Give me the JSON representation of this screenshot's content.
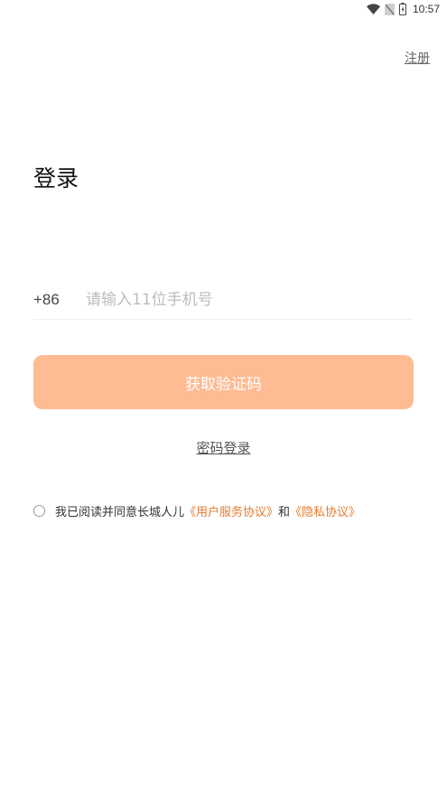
{
  "status_bar": {
    "time": "10:57",
    "icons": [
      "wifi-icon",
      "no-signal-icon",
      "battery-icon"
    ]
  },
  "header": {
    "register_label": "注册"
  },
  "title": "登录",
  "phone": {
    "country_code": "+86",
    "placeholder": "请输入11位手机号",
    "value": ""
  },
  "sms_button_label": "获取验证码",
  "password_login_label": "密码登录",
  "agreement": {
    "checked": false,
    "text": "我已阅读并同意长城人儿",
    "user_agreement": "《用户服务协议》",
    "and": "和",
    "privacy_agreement": "《隐私协议》"
  },
  "colors": {
    "button_bg": "#ffbb92",
    "link_orange": "#e87a2b",
    "background": "#ffffff"
  }
}
